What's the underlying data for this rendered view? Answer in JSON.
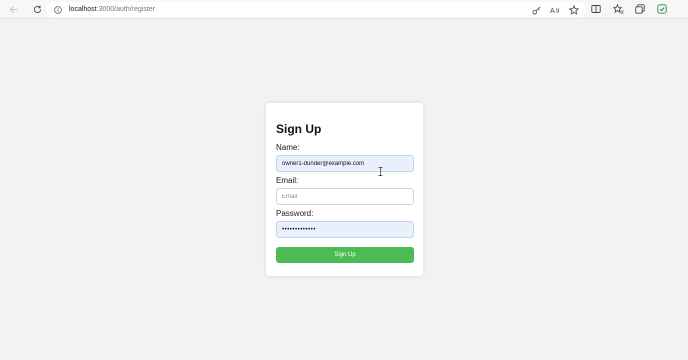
{
  "browser": {
    "url_host": "localhost",
    "url_path": ":3000/auth/register",
    "icons": [
      "back-icon",
      "refresh-icon",
      "info-icon",
      "key-icon",
      "read-aloud-icon",
      "favorite-icon",
      "split-screen-icon",
      "favorites-bar-icon",
      "collections-icon",
      "browser-essentials-icon"
    ]
  },
  "form": {
    "title": "Sign Up",
    "name_label": "Name:",
    "name_value": "owner1-dunder@example.com",
    "email_label": "Email:",
    "email_placeholder": "Email",
    "email_value": "",
    "password_label": "Password:",
    "password_value": "password12345",
    "submit_label": "Sign Up"
  },
  "colors": {
    "page_background": "#f2f2f2",
    "button_green": "#4cbb55",
    "autofill_blue": "#e8f0fe"
  }
}
